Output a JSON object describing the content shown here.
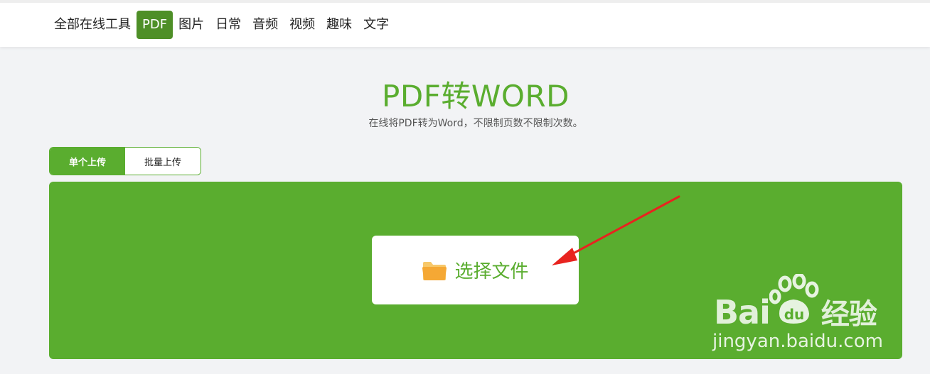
{
  "nav": {
    "items": [
      {
        "label": "全部在线工具",
        "active": false
      },
      {
        "label": "PDF",
        "active": true
      },
      {
        "label": "图片",
        "active": false
      },
      {
        "label": "日常",
        "active": false
      },
      {
        "label": "音频",
        "active": false
      },
      {
        "label": "视频",
        "active": false
      },
      {
        "label": "趣味",
        "active": false
      },
      {
        "label": "文字",
        "active": false
      }
    ]
  },
  "page": {
    "title": "PDF转WORD",
    "subtitle": "在线将PDF转为Word，不限制页数不限制次数。"
  },
  "tabs": {
    "single": "单个上传",
    "batch": "批量上传",
    "active": "single"
  },
  "upload": {
    "button_label": "选择文件",
    "icon": "folder-icon"
  },
  "watermark": {
    "brand": "Bai",
    "brand_tail": "经验",
    "url": "jingyan.baidu.com"
  },
  "colors": {
    "accent": "#5aad2f",
    "nav_active": "#4e8f27",
    "background": "#f2f3f5",
    "folder": "#f5b33a",
    "arrow": "#e8231f"
  }
}
